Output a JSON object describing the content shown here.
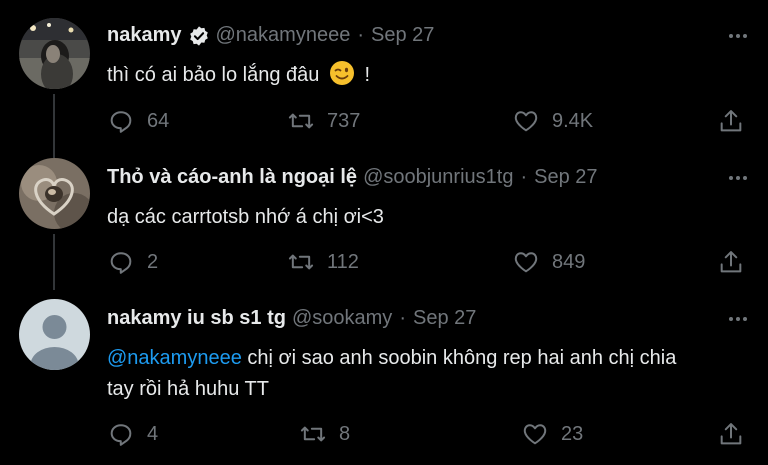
{
  "tweets": [
    {
      "display_name": "nakamy",
      "handle": "@nakamyneee",
      "separator": "·",
      "date": "Sep 27",
      "verified": true,
      "text": "thì có ai bảo lo lắng đâu",
      "text_suffix": "!",
      "emoji": "winking-face",
      "counts": {
        "replies": "64",
        "retweets": "737",
        "likes": "9.4K"
      }
    },
    {
      "display_name": "Thỏ và cáo-anh là ngoại lệ",
      "handle": "@soobjunrius1tg",
      "separator": "·",
      "date": "Sep 27",
      "verified": false,
      "text": "dạ các carrtotsb nhớ á chị ơi<3",
      "counts": {
        "replies": "2",
        "retweets": "112",
        "likes": "849"
      }
    },
    {
      "display_name": "nakamy iu sb s1 tg",
      "handle": "@sookamy",
      "separator": "·",
      "date": "Sep 27",
      "verified": false,
      "mention": "@nakamyneee",
      "text_after_mention": " chị ơi sao anh soobin không rep hai anh chị chia",
      "text_line2": "tay rồi hả huhu TT",
      "counts": {
        "replies": "4",
        "retweets": "8",
        "likes": "23"
      }
    }
  ],
  "icons": [
    "reply-icon",
    "retweet-icon",
    "like-icon",
    "share-icon",
    "more-icon",
    "verified-badge-icon"
  ],
  "colors": {
    "background": "#000000",
    "text": "#e7e9ea",
    "muted": "#71767b",
    "accent": "#1d9bf0",
    "thread_line": "#333639"
  }
}
